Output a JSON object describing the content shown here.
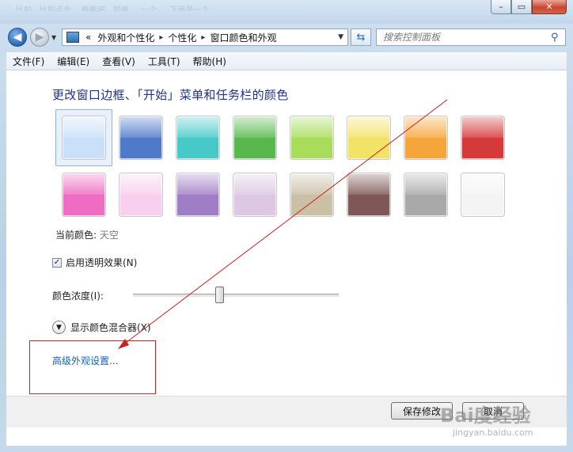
{
  "window": {
    "buttons": {
      "minimize": "–",
      "maximize": "▭",
      "close": "✕"
    },
    "background_text": "比如，比如点击... 看看吧，如果 ... 一个 ... 下面是一个 ..."
  },
  "nav": {
    "breadcrumb_prefix": "«",
    "crumbs": [
      "外观和个性化",
      "个性化",
      "窗口颜色和外观"
    ],
    "search_placeholder": "搜索控制面板"
  },
  "menu": [
    "文件(F)",
    "编辑(E)",
    "查看(V)",
    "工具(T)",
    "帮助(H)"
  ],
  "main": {
    "heading": "更改窗口边框、「开始」菜单和任务栏的颜色",
    "current_color_label": "当前颜色:",
    "current_color_value": "天空",
    "transparency_label": "启用透明效果(N)",
    "transparency_checked": true,
    "intensity_label": "颜色浓度(I):",
    "intensity_value": 0.42,
    "mixer_label": "显示颜色混合器(X)",
    "advanced_link": "高级外观设置..."
  },
  "swatches": [
    {
      "name": "sky",
      "color": "#c9e0f8",
      "selected": true
    },
    {
      "name": "twilight",
      "color": "#4f79c9"
    },
    {
      "name": "sea",
      "color": "#47c9c9"
    },
    {
      "name": "leaf",
      "color": "#58b84e"
    },
    {
      "name": "lime",
      "color": "#a8dc5a"
    },
    {
      "name": "lemon",
      "color": "#f2e266"
    },
    {
      "name": "tangerine",
      "color": "#f6a53b"
    },
    {
      "name": "ruby",
      "color": "#d6393a"
    },
    {
      "name": "fuchsia",
      "color": "#ee6cc1"
    },
    {
      "name": "blush",
      "color": "#f8cfee"
    },
    {
      "name": "violet",
      "color": "#a07ec6"
    },
    {
      "name": "lavender",
      "color": "#ddc7e2"
    },
    {
      "name": "taupe",
      "color": "#cbbfa6"
    },
    {
      "name": "chocolate",
      "color": "#7e5756"
    },
    {
      "name": "slate",
      "color": "#a9a9a9"
    },
    {
      "name": "frost",
      "color": "#f4f4f4"
    }
  ],
  "footer": {
    "save": "保存修改",
    "cancel": "取消"
  },
  "watermark": {
    "main": "Bai度经验",
    "sub": "jingyan.baidu.com"
  }
}
